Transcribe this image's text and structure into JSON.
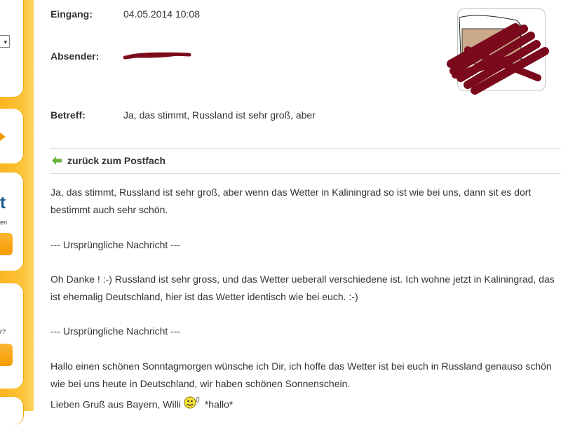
{
  "sidebar": {
    "big_letter": "t",
    "small_text_1": "en",
    "small_text_2": "r?"
  },
  "header": {
    "eingang_label": "Eingang:",
    "eingang_value": "04.05.2014 10:08",
    "absender_label": "Absender:",
    "betreff_label": "Betreff:",
    "betreff_value": "Ja, das stimmt, Russland ist sehr groß, aber"
  },
  "nav": {
    "back_label": "zurück zum Postfach"
  },
  "message": {
    "p1_line1": "Ja, das stimmt, Russland ist sehr groß, aber wenn das Wetter in Kaliningrad so ist wie bei uns, dann sit es dort",
    "p1_line2": "bestimmt auch sehr schön.",
    "quote1": "--- Ursprüngliche Nachricht ---",
    "p2_line1": "Oh Danke ! :-) Russland ist sehr gross, und das Wetter ueberall verschiedene ist. Ich wohne jetzt in Kaliningrad, das",
    "p2_line2": "ist ehemalig Deutschland, hier ist das Wetter identisch wie bei euch. :-)",
    "quote2": "--- Ursprüngliche Nachricht ---",
    "p3_line1": "Hallo einen schönen Sonntagmorgen wünsche ich Dir, ich hoffe das Wetter ist bei euch in Russland genauso schön",
    "p3_line2": "wie bei uns heute in Deutschland, wir haben schönen Sonnenschein.",
    "p3_line3": "Lieben Gruß aus Bayern, Willi",
    "smiley_caption": "*hallo*"
  },
  "colors": {
    "sidebar_orange": "#fbb51f",
    "redaction": "#7a0a1c",
    "back_arrow": "#6cb33f"
  }
}
